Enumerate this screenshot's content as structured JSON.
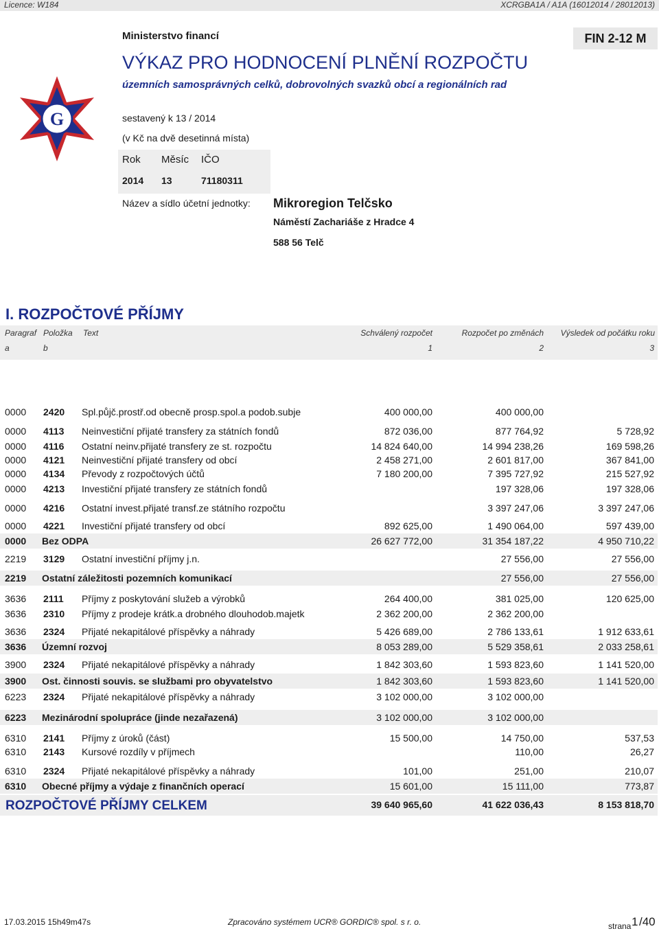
{
  "header": {
    "licence": "Licence: W184",
    "version": "XCRGBA1A / A1A  (16012014 / 28012013)",
    "ministry": "Ministerstvo financí",
    "form_code": "FIN 2-12 M",
    "title": "VÝKAZ PRO HODNOCENÍ PLNĚNÍ ROZPOČTU",
    "subtitle": "územních samosprávných celků, dobrovolných svazků obcí a regionálních rad",
    "compiled": "sestavený k  13 / 2014",
    "units": "(v Kč na dvě desetinná místa)",
    "id_labels": {
      "rok": "Rok",
      "mesic": "Měsíc",
      "ico": "IČO"
    },
    "id_values": {
      "rok": "2014",
      "mesic": "13",
      "ico": "71180311"
    },
    "entity_label": "Název a sídlo účetní jednotky:",
    "entity_name": "Mikroregion Telčsko",
    "entity_address": "Náměstí Zachariáše z Hradce 4",
    "entity_city": "588 56  Telč"
  },
  "section_title": "I. ROZPOČTOVÉ PŘÍJMY",
  "columns": {
    "paragraf": "Paragraf",
    "polozka": "Položka",
    "text": "Text",
    "schvaleny": "Schválený rozpočet",
    "zmeny": "Rozpočet po změnách",
    "vysledek": "Výsledek od počátku roku",
    "a": "a",
    "b": "b",
    "n1": "1",
    "n2": "2",
    "n3": "3"
  },
  "rows": [
    {
      "par": "0000",
      "pol": "2420",
      "text": "Spl.půjč.prostř.od obecně prosp.spol.a podob.subje",
      "v1": "400 000,00",
      "v2": "400 000,00",
      "v3": ""
    },
    {
      "par": "0000",
      "pol": "4113",
      "text": "Neinvestiční přijaté transfery za státních fondů",
      "v1": "872 036,00",
      "v2": "877 764,92",
      "v3": "5 728,92"
    },
    {
      "par": "0000",
      "pol": "4116",
      "text": "Ostatní neinv.přijaté transfery ze st. rozpočtu",
      "v1": "14 824 640,00",
      "v2": "14 994 238,26",
      "v3": "169 598,26"
    },
    {
      "par": "0000",
      "pol": "4121",
      "text": "Neinvestiční přijaté transfery od obcí",
      "v1": "2 458 271,00",
      "v2": "2 601 817,00",
      "v3": "367 841,00"
    },
    {
      "par": "0000",
      "pol": "4134",
      "text": "Převody z rozpočtových účtů",
      "v1": "7 180 200,00",
      "v2": "7 395 727,92",
      "v3": "215 527,92"
    },
    {
      "par": "0000",
      "pol": "4213",
      "text": "Investiční přijaté transfery ze státních fondů",
      "v1": "",
      "v2": "197 328,06",
      "v3": "197 328,06"
    },
    {
      "par": "0000",
      "pol": "4216",
      "text": "Ostatní invest.přijaté transf.ze státního rozpočtu",
      "v1": "",
      "v2": "3 397 247,06",
      "v3": "3 397 247,06"
    },
    {
      "par": "0000",
      "pol": "4221",
      "text": "Investiční přijaté transfery od obcí",
      "v1": "892 625,00",
      "v2": "1 490 064,00",
      "v3": "597 439,00"
    },
    {
      "sum": true,
      "par": "0000",
      "label": "Bez ODPA",
      "v1": "26 627 772,00",
      "v2": "31 354 187,22",
      "v3": "4 950 710,22"
    },
    {
      "par": "2219",
      "pol": "3129",
      "text": "Ostatní investiční příjmy j.n.",
      "v1": "",
      "v2": "27 556,00",
      "v3": "27 556,00"
    },
    {
      "sum": true,
      "par": "2219",
      "label": "Ostatní záležitosti pozemních komunikací",
      "v1": "",
      "v2": "27 556,00",
      "v3": "27 556,00"
    },
    {
      "par": "3636",
      "pol": "2111",
      "text": "Příjmy z poskytování služeb a výrobků",
      "v1": "264 400,00",
      "v2": "381 025,00",
      "v3": "120 625,00"
    },
    {
      "par": "3636",
      "pol": "2310",
      "text": "Příjmy z prodeje krátk.a drobného dlouhodob.majetk",
      "v1": "2 362 200,00",
      "v2": "2 362 200,00",
      "v3": ""
    },
    {
      "par": "3636",
      "pol": "2324",
      "text": "Přijaté nekapitálové příspěvky a náhrady",
      "v1": "5 426 689,00",
      "v2": "2 786 133,61",
      "v3": "1 912 633,61"
    },
    {
      "sum": true,
      "par": "3636",
      "label": "Územní rozvoj",
      "v1": "8 053 289,00",
      "v2": "5 529 358,61",
      "v3": "2 033 258,61"
    },
    {
      "par": "3900",
      "pol": "2324",
      "text": "Přijaté nekapitálové příspěvky a náhrady",
      "v1": "1 842 303,60",
      "v2": "1 593 823,60",
      "v3": "1 141 520,00"
    },
    {
      "sum": true,
      "par": "3900",
      "label": "Ost. činnosti souvis. se službami pro obyvatelstvo",
      "v1": "1 842 303,60",
      "v2": "1 593 823,60",
      "v3": "1 141 520,00"
    },
    {
      "par": "6223",
      "pol": "2324",
      "text": "Přijaté nekapitálové příspěvky a náhrady",
      "v1": "3 102 000,00",
      "v2": "3 102 000,00",
      "v3": ""
    },
    {
      "sum": true,
      "par": "6223",
      "label": "Mezinárodní spolupráce (jinde nezařazená)",
      "v1": "3 102 000,00",
      "v2": "3 102 000,00",
      "v3": ""
    },
    {
      "par": "6310",
      "pol": "2141",
      "text": "Příjmy z úroků (část)",
      "v1": "15 500,00",
      "v2": "14 750,00",
      "v3": "537,53"
    },
    {
      "par": "6310",
      "pol": "2143",
      "text": "Kursové rozdíly v příjmech",
      "v1": "",
      "v2": "110,00",
      "v3": "26,27"
    },
    {
      "par": "6310",
      "pol": "2324",
      "text": "Přijaté nekapitálové příspěvky a náhrady",
      "v1": "101,00",
      "v2": "251,00",
      "v3": "210,07"
    },
    {
      "sum": true,
      "par": "6310",
      "label": "Obecné příjmy a výdaje z finančních operací",
      "v1": "15 601,00",
      "v2": "15 111,00",
      "v3": "773,87"
    }
  ],
  "total": {
    "label": "ROZPOČTOVÉ PŘÍJMY CELKEM",
    "v1": "39 640 965,60",
    "v2": "41 622 036,43",
    "v3": "8 153 818,70"
  },
  "footer": {
    "timestamp": "17.03.2015 15h49m47s",
    "system": "Zpracováno systémem  UCR® GORDIC® spol. s  r. o.",
    "page_prefix": "strana",
    "page_num": "1",
    "page_total": "/40"
  },
  "colors": {
    "title_blue": "#1e2f8c",
    "logo_red": "#c8282d",
    "logo_blue": "#1e2f8c",
    "shade": "#eeeeee"
  },
  "icons": {
    "logo": "ministry-star-logo"
  }
}
